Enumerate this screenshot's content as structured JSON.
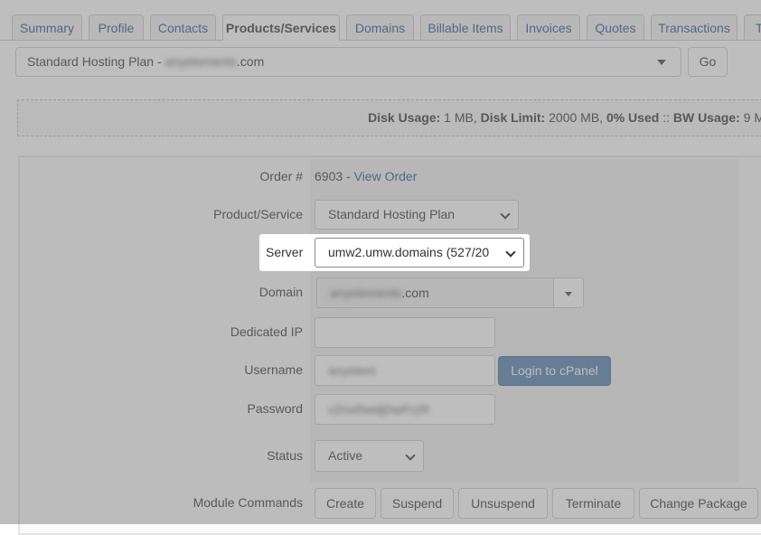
{
  "tabs": [
    {
      "label": "Summary",
      "active": false
    },
    {
      "label": "Profile",
      "active": false
    },
    {
      "label": "Contacts",
      "active": false
    },
    {
      "label": "Products/Services",
      "active": true
    },
    {
      "label": "Domains",
      "active": false
    },
    {
      "label": "Billable Items",
      "active": false
    },
    {
      "label": "Invoices",
      "active": false
    },
    {
      "label": "Quotes",
      "active": false
    },
    {
      "label": "Transactions",
      "active": false
    },
    {
      "label": "T",
      "active": false
    }
  ],
  "product_selector": {
    "plan": "Standard Hosting Plan - ",
    "domain_blurred": "anyelements",
    "domain_suffix": ".com",
    "go_label": "Go"
  },
  "usage": {
    "disk_usage_label": "Disk Usage:",
    "disk_usage_value": " 1 MB, ",
    "disk_limit_label": "Disk Limit:",
    "disk_limit_value": " 2000 MB, ",
    "used_label": "0% Used",
    "sep": " :: ",
    "bw_label": "BW Usage:",
    "bw_value": " 9 M"
  },
  "form": {
    "order_label": "Order #",
    "order_number": "6903 - ",
    "view_order": "View Order",
    "product_label": "Product/Service",
    "product_value": "Standard Hosting Plan",
    "server_label": "Server",
    "server_value": "umw2.umw.domains (527/20",
    "domain_label": "Domain",
    "domain_blurred": "anyelements",
    "domain_suffix": ".com",
    "dedicated_ip_label": "Dedicated IP",
    "dedicated_ip_value": "",
    "username_label": "Username",
    "username_blurred": "anyelem",
    "login_cpanel": "Login to cPanel",
    "password_label": "Password",
    "password_blurred": "vZnxRwdjDwFrzR",
    "status_label": "Status",
    "status_value": "Active",
    "module_label": "Module Commands",
    "module_buttons": [
      "Create",
      "Suspend",
      "Unsuspend",
      "Terminate",
      "Change Package"
    ]
  }
}
